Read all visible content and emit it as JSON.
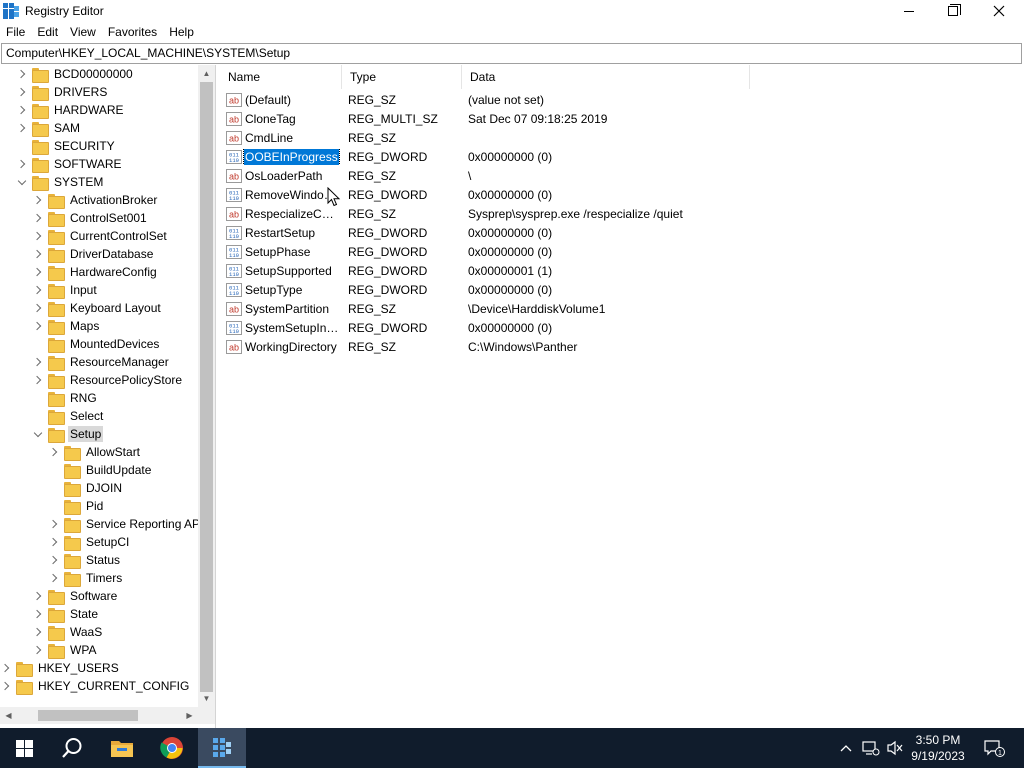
{
  "window": {
    "title": "Registry Editor",
    "minimize": "Minimize",
    "maximize": "Maximize",
    "close": "Close"
  },
  "menu": [
    "File",
    "Edit",
    "View",
    "Favorites",
    "Help"
  ],
  "address": "Computer\\HKEY_LOCAL_MACHINE\\SYSTEM\\Setup",
  "tree": [
    {
      "label": "BCD00000000",
      "expander": "collapsed",
      "depth": 1
    },
    {
      "label": "DRIVERS",
      "expander": "collapsed",
      "depth": 1
    },
    {
      "label": "HARDWARE",
      "expander": "collapsed",
      "depth": 1
    },
    {
      "label": "SAM",
      "expander": "collapsed",
      "depth": 1
    },
    {
      "label": "SECURITY",
      "expander": "none",
      "depth": 1
    },
    {
      "label": "SOFTWARE",
      "expander": "collapsed",
      "depth": 1
    },
    {
      "label": "SYSTEM",
      "expander": "expanded",
      "depth": 1
    },
    {
      "label": "ActivationBroker",
      "expander": "collapsed",
      "depth": 2
    },
    {
      "label": "ControlSet001",
      "expander": "collapsed",
      "depth": 2
    },
    {
      "label": "CurrentControlSet",
      "expander": "collapsed",
      "depth": 2
    },
    {
      "label": "DriverDatabase",
      "expander": "collapsed",
      "depth": 2
    },
    {
      "label": "HardwareConfig",
      "expander": "collapsed",
      "depth": 2
    },
    {
      "label": "Input",
      "expander": "collapsed",
      "depth": 2
    },
    {
      "label": "Keyboard Layout",
      "expander": "collapsed",
      "depth": 2
    },
    {
      "label": "Maps",
      "expander": "collapsed",
      "depth": 2
    },
    {
      "label": "MountedDevices",
      "expander": "none",
      "depth": 2
    },
    {
      "label": "ResourceManager",
      "expander": "collapsed",
      "depth": 2
    },
    {
      "label": "ResourcePolicyStore",
      "expander": "collapsed",
      "depth": 2
    },
    {
      "label": "RNG",
      "expander": "none",
      "depth": 2
    },
    {
      "label": "Select",
      "expander": "none",
      "depth": 2
    },
    {
      "label": "Setup",
      "expander": "expanded",
      "depth": 2,
      "selected": true
    },
    {
      "label": "AllowStart",
      "expander": "collapsed",
      "depth": 3
    },
    {
      "label": "BuildUpdate",
      "expander": "none",
      "depth": 3
    },
    {
      "label": "DJOIN",
      "expander": "none",
      "depth": 3
    },
    {
      "label": "Pid",
      "expander": "none",
      "depth": 3
    },
    {
      "label": "Service Reporting API",
      "expander": "collapsed",
      "depth": 3
    },
    {
      "label": "SetupCI",
      "expander": "collapsed",
      "depth": 3
    },
    {
      "label": "Status",
      "expander": "collapsed",
      "depth": 3
    },
    {
      "label": "Timers",
      "expander": "collapsed",
      "depth": 3
    },
    {
      "label": "Software",
      "expander": "collapsed",
      "depth": 2
    },
    {
      "label": "State",
      "expander": "collapsed",
      "depth": 2
    },
    {
      "label": "WaaS",
      "expander": "collapsed",
      "depth": 2
    },
    {
      "label": "WPA",
      "expander": "collapsed",
      "depth": 2
    },
    {
      "label": "HKEY_USERS",
      "expander": "collapsed",
      "depth": 0
    },
    {
      "label": "HKEY_CURRENT_CONFIG",
      "expander": "collapsed",
      "depth": 0
    }
  ],
  "columns": {
    "name": "Name",
    "type": "Type",
    "data": "Data"
  },
  "values": [
    {
      "name": "(Default)",
      "type": "REG_SZ",
      "data": "(value not set)",
      "icon": "string-value-icon"
    },
    {
      "name": "CloneTag",
      "type": "REG_MULTI_SZ",
      "data": "Sat Dec 07 09:18:25 2019",
      "icon": "string-value-icon"
    },
    {
      "name": "CmdLine",
      "type": "REG_SZ",
      "data": "",
      "icon": "string-value-icon"
    },
    {
      "name": "OOBEInProgress",
      "type": "REG_DWORD",
      "data": "0x00000000 (0)",
      "icon": "binary-value-icon",
      "selected": true
    },
    {
      "name": "OsLoaderPath",
      "type": "REG_SZ",
      "data": "\\",
      "icon": "string-value-icon"
    },
    {
      "name": "RemoveWindowsOld",
      "type": "REG_DWORD",
      "data": "0x00000000 (0)",
      "icon": "binary-value-icon"
    },
    {
      "name": "RespecializeCmdLine",
      "type": "REG_SZ",
      "data": "Sysprep\\sysprep.exe /respecialize /quiet",
      "icon": "string-value-icon"
    },
    {
      "name": "RestartSetup",
      "type": "REG_DWORD",
      "data": "0x00000000 (0)",
      "icon": "binary-value-icon"
    },
    {
      "name": "SetupPhase",
      "type": "REG_DWORD",
      "data": "0x00000000 (0)",
      "icon": "binary-value-icon"
    },
    {
      "name": "SetupSupported",
      "type": "REG_DWORD",
      "data": "0x00000001 (1)",
      "icon": "binary-value-icon"
    },
    {
      "name": "SetupType",
      "type": "REG_DWORD",
      "data": "0x00000000 (0)",
      "icon": "binary-value-icon"
    },
    {
      "name": "SystemPartition",
      "type": "REG_SZ",
      "data": "\\Device\\HarddiskVolume1",
      "icon": "string-value-icon"
    },
    {
      "name": "SystemSetupInProgress",
      "type": "REG_DWORD",
      "data": "0x00000000 (0)",
      "icon": "binary-value-icon"
    },
    {
      "name": "WorkingDirectory",
      "type": "REG_SZ",
      "data": "C:\\Windows\\Panther",
      "icon": "string-value-icon"
    }
  ],
  "taskbar": {
    "apps": [
      "start-icon",
      "search-icon",
      "file-explorer-icon",
      "chrome-icon",
      "regedit-icon"
    ],
    "clock_time": "3:50 PM",
    "clock_date": "9/19/2023",
    "notification_count": "1"
  },
  "colors": {
    "selection": "#0078d7",
    "taskbar": "#101c2c",
    "folder": "#f5c94c"
  }
}
